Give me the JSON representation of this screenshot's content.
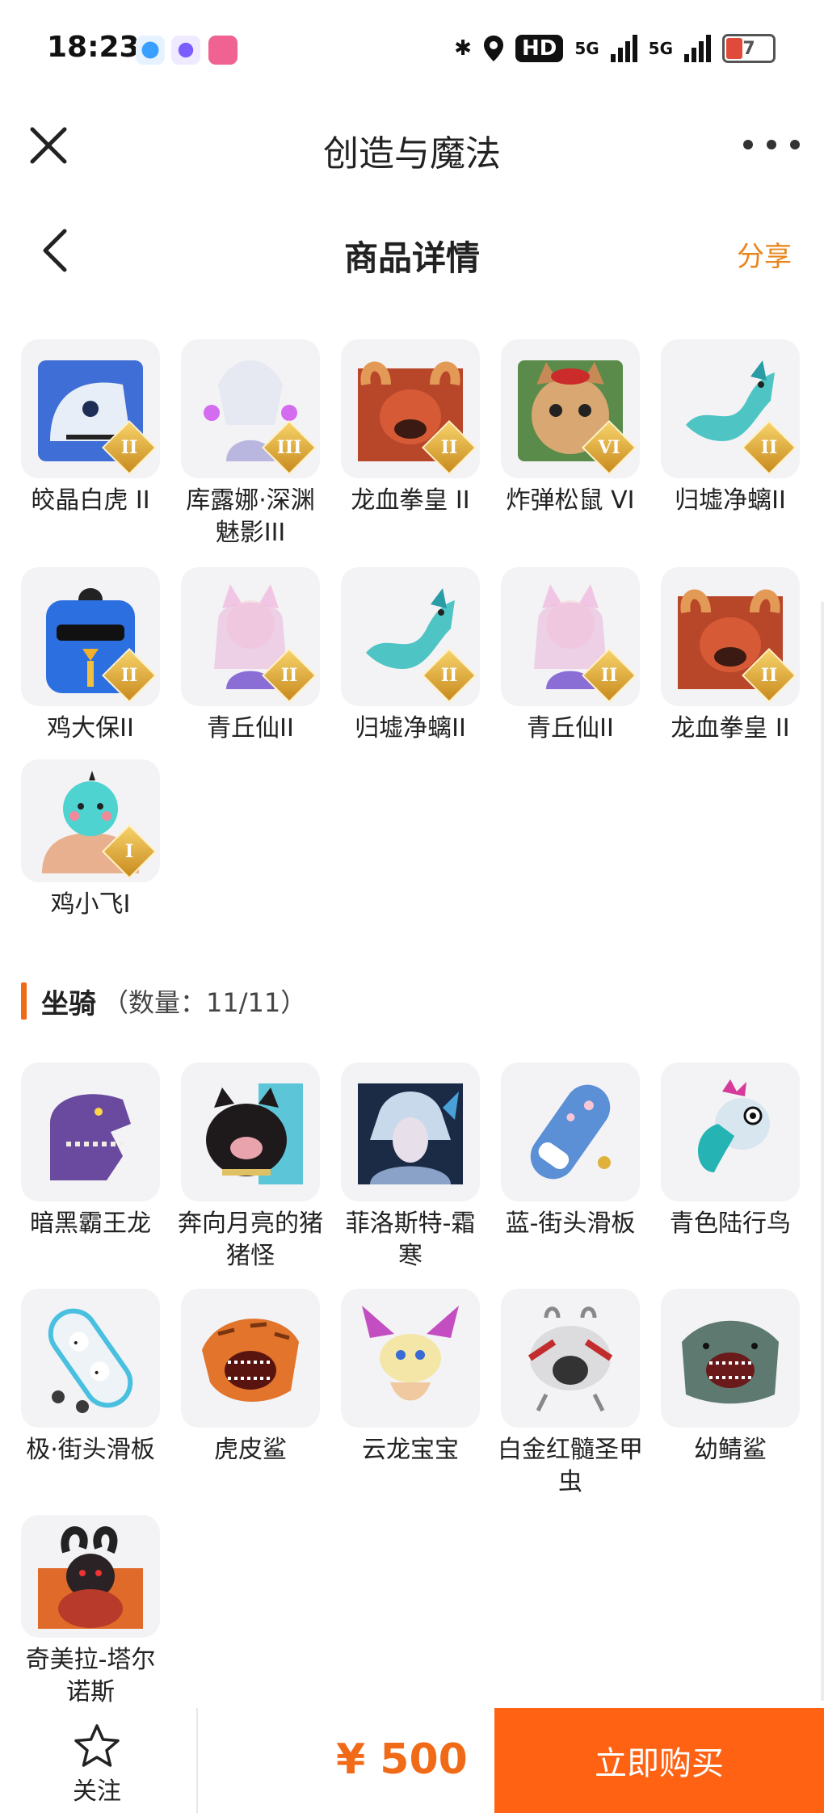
{
  "status_bar": {
    "time": "18:23",
    "network_1": "5G",
    "network_2": "5G",
    "hd": "HD",
    "battery": "7",
    "battery_color": "#e04a3a"
  },
  "top_bar": {
    "title": "创造与魔法"
  },
  "page_header": {
    "title": "商品详情",
    "share_label": "分享"
  },
  "pets": [
    {
      "label": "皎晶白虎 II",
      "badge": "II",
      "icon": "white-tiger-icon"
    },
    {
      "label": "库露娜·深渊魅影III",
      "badge": "III",
      "icon": "abyss-phantom-icon"
    },
    {
      "label": "龙血拳皇 II",
      "badge": "II",
      "icon": "dragon-boxer-icon"
    },
    {
      "label": "炸弹松鼠 VI",
      "badge": "VI",
      "icon": "bomb-squirrel-icon"
    },
    {
      "label": "归墟净螭II",
      "badge": "II",
      "icon": "sea-dragon-icon"
    },
    {
      "label": "鸡大保II",
      "badge": "II",
      "icon": "chicken-boss-icon"
    },
    {
      "label": "青丘仙II",
      "badge": "II",
      "icon": "fox-fairy-icon"
    },
    {
      "label": "归墟净螭II",
      "badge": "II",
      "icon": "sea-dragon-icon"
    },
    {
      "label": "青丘仙II",
      "badge": "II",
      "icon": "fox-fairy-icon"
    },
    {
      "label": "龙血拳皇 II",
      "badge": "II",
      "icon": "dragon-boxer-icon"
    },
    {
      "label": "鸡小飞I",
      "badge": "I",
      "icon": "chick-fly-icon"
    }
  ],
  "mounts_section": {
    "name": "坐骑",
    "count": "（数量：11/11）",
    "accent": "#f06a17"
  },
  "mounts": [
    {
      "label": "暗黑霸王龙",
      "icon": "dark-trex-icon"
    },
    {
      "label": "奔向月亮的猪猪怪",
      "icon": "moon-pig-icon"
    },
    {
      "label": "菲洛斯特-霜寒",
      "icon": "frost-warrior-icon"
    },
    {
      "label": "蓝-街头滑板",
      "icon": "blue-skateboard-icon"
    },
    {
      "label": "青色陆行鸟",
      "icon": "cyan-bird-icon"
    },
    {
      "label": "极·街头滑板",
      "icon": "ultimate-skateboard-icon"
    },
    {
      "label": "虎皮鲨",
      "icon": "tiger-shark-icon"
    },
    {
      "label": "云龙宝宝",
      "icon": "cloud-dragon-icon"
    },
    {
      "label": "白金红髓圣甲虫",
      "icon": "platinum-scarab-icon"
    },
    {
      "label": "幼鲭鲨",
      "icon": "young-shark-icon"
    },
    {
      "label": "奇美拉-塔尔诺斯",
      "icon": "chimera-icon"
    }
  ],
  "bottom_bar": {
    "follow_label": "关注",
    "price": "¥ 500",
    "buy_label": "立即购买",
    "buy_color": "#ff6212"
  }
}
